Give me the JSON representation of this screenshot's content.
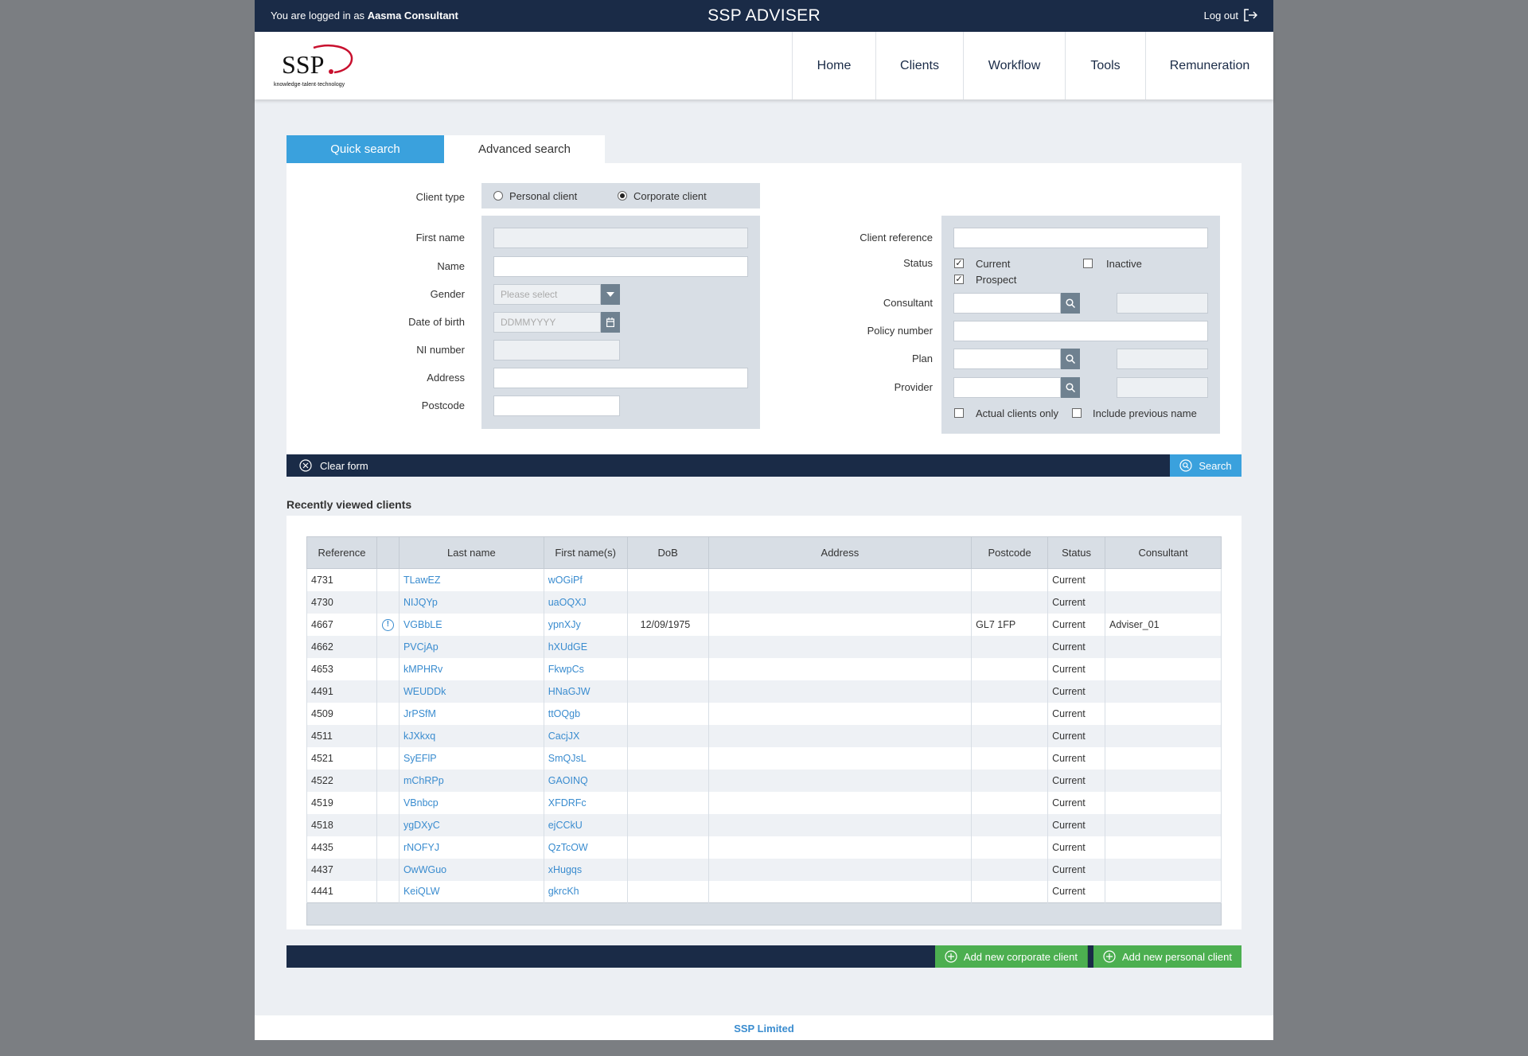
{
  "topbar": {
    "logged_in_prefix": "You are logged in as",
    "user_name": "Aasma Consultant",
    "app_title": "SSP ADVISER",
    "logout_label": "Log out"
  },
  "logo": {
    "text": "SSP.",
    "tagline": "knowledge·talent·technology"
  },
  "nav": [
    "Home",
    "Clients",
    "Workflow",
    "Tools",
    "Remuneration"
  ],
  "tabs": {
    "quick": "Quick search",
    "advanced": "Advanced search"
  },
  "form": {
    "client_type_label": "Client type",
    "client_type_options": [
      "Personal client",
      "Corporate client"
    ],
    "client_type_selected": "Corporate client",
    "first_name_label": "First name",
    "name_label": "Name",
    "gender_label": "Gender",
    "gender_placeholder": "Please select",
    "dob_label": "Date of birth",
    "dob_placeholder": "DDMMYYYY",
    "ni_label": "NI number",
    "address_label": "Address",
    "postcode_label": "Postcode",
    "client_ref_label": "Client reference",
    "status_label": "Status",
    "status_current": "Current",
    "status_inactive": "Inactive",
    "status_prospect": "Prospect",
    "consultant_label": "Consultant",
    "policy_label": "Policy number",
    "plan_label": "Plan",
    "provider_label": "Provider",
    "actual_clients_label": "Actual clients only",
    "include_prev_label": "Include previous name"
  },
  "actions": {
    "clear_form": "Clear form",
    "search": "Search",
    "add_corporate": "Add new corporate client",
    "add_personal": "Add new personal client"
  },
  "recent": {
    "title": "Recently viewed clients",
    "columns": [
      "Reference",
      "",
      "Last name",
      "First name(s)",
      "DoB",
      "Address",
      "Postcode",
      "Status",
      "Consultant"
    ],
    "rows": [
      [
        "4731",
        "",
        "TLawEZ",
        "wOGiPf",
        "",
        "",
        "",
        "Current",
        ""
      ],
      [
        "4730",
        "",
        "NIJQYp",
        "uaOQXJ",
        "",
        "",
        "",
        "Current",
        ""
      ],
      [
        "4667",
        "!",
        "VGBbLE",
        "ypnXJy",
        "12/09/1975",
        "",
        "GL7 1FP",
        "Current",
        "Adviser_01"
      ],
      [
        "4662",
        "",
        "PVCjAp",
        "hXUdGE",
        "",
        "",
        "",
        "Current",
        ""
      ],
      [
        "4653",
        "",
        "kMPHRv",
        "FkwpCs",
        "",
        "",
        "",
        "Current",
        ""
      ],
      [
        "4491",
        "",
        "WEUDDk",
        "HNaGJW",
        "",
        "",
        "",
        "Current",
        ""
      ],
      [
        "4509",
        "",
        "JrPSfM",
        "ttOQgb",
        "",
        "",
        "",
        "Current",
        ""
      ],
      [
        "4511",
        "",
        "kJXkxq",
        "CacjJX",
        "",
        "",
        "",
        "Current",
        ""
      ],
      [
        "4521",
        "",
        "SyEFlP",
        "SmQJsL",
        "",
        "",
        "",
        "Current",
        ""
      ],
      [
        "4522",
        "",
        "mChRPp",
        "GAOINQ",
        "",
        "",
        "",
        "Current",
        ""
      ],
      [
        "4519",
        "",
        "VBnbcp",
        "XFDRFc",
        "",
        "",
        "",
        "Current",
        ""
      ],
      [
        "4518",
        "",
        "ygDXyC",
        "ejCCkU",
        "",
        "",
        "",
        "Current",
        ""
      ],
      [
        "4435",
        "",
        "rNOFYJ",
        "QzTcOW",
        "",
        "",
        "",
        "Current",
        ""
      ],
      [
        "4437",
        "",
        "OwWGuo",
        "xHugqs",
        "",
        "",
        "",
        "Current",
        ""
      ],
      [
        "4441",
        "",
        "KeiQLW",
        "gkrcKh",
        "",
        "",
        "",
        "Current",
        ""
      ]
    ]
  },
  "footer": {
    "text": "SSP Limited"
  },
  "colors": {
    "navy": "#1a2b47",
    "accent_blue": "#3aa1dd",
    "green": "#4caf50",
    "link": "#3a8ccf"
  }
}
